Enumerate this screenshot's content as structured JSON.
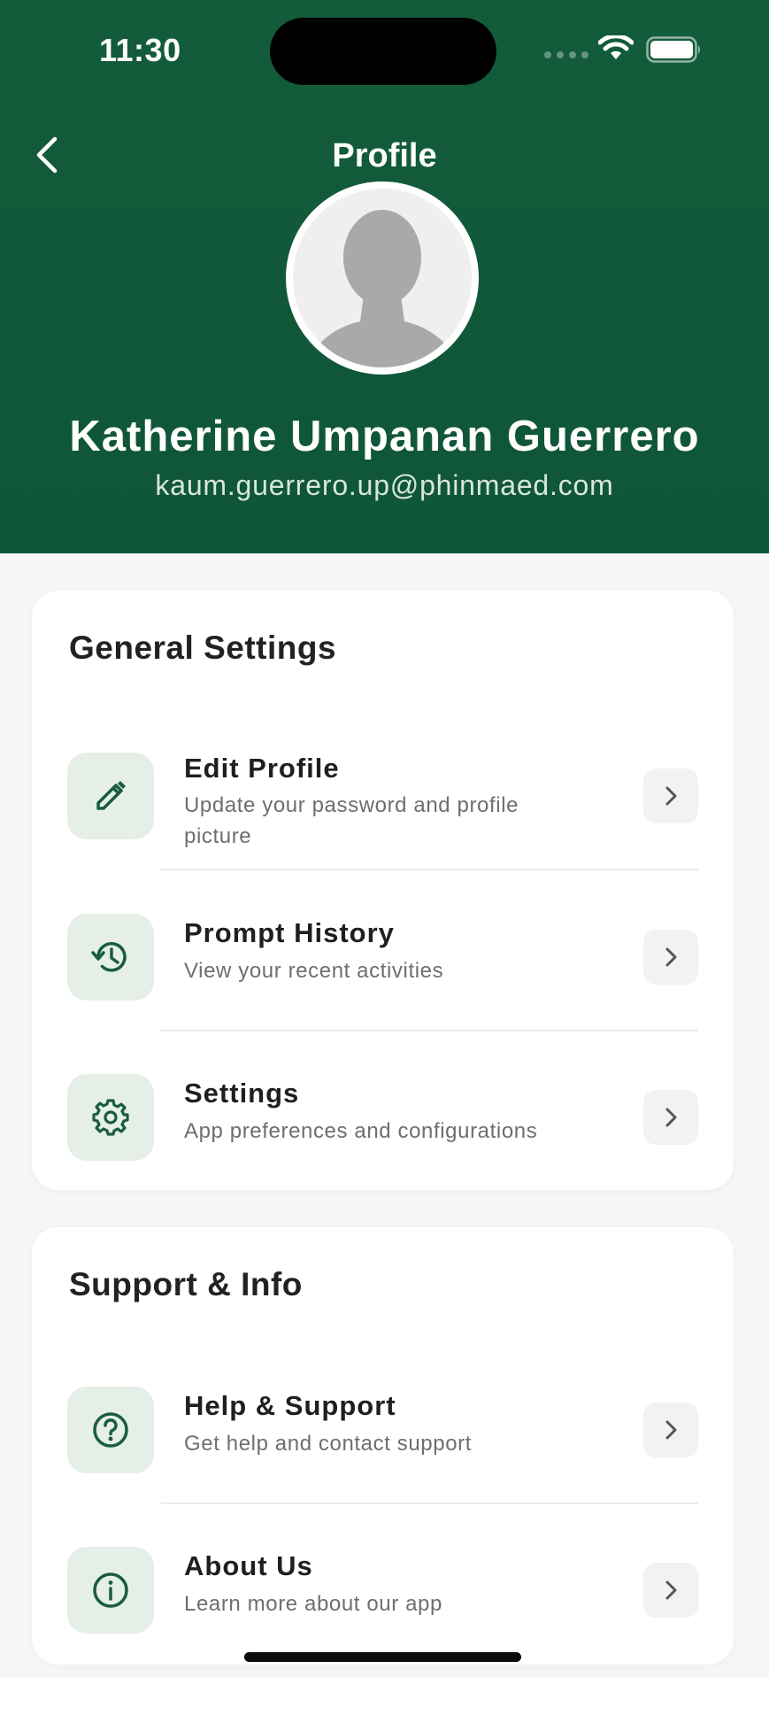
{
  "status_bar": {
    "time": "11:30"
  },
  "header": {
    "title": "Profile",
    "back_icon": "chevron-left-icon",
    "avatar_icon": "person-silhouette-icon",
    "user_name": "Katherine Umpanan Guerrero",
    "user_email": "kaum.guerrero.up@phinmaed.com"
  },
  "general_settings": {
    "title": "General Settings",
    "items": [
      {
        "title": "Edit Profile",
        "subtitle": "Update your password and profile picture",
        "icon": "pencil-icon"
      },
      {
        "title": "Prompt History",
        "subtitle": "View your recent activities",
        "icon": "history-icon"
      },
      {
        "title": "Settings",
        "subtitle": "App preferences and configurations",
        "icon": "gear-icon"
      }
    ]
  },
  "support_info": {
    "title": "Support & Info",
    "items": [
      {
        "title": "Help & Support",
        "subtitle": "Get help and contact support",
        "icon": "question-circle-icon"
      },
      {
        "title": "About Us",
        "subtitle": "Learn more about our app",
        "icon": "info-circle-icon"
      }
    ]
  },
  "colors": {
    "header_bg": "#125a3a",
    "accent": "#1a5c3f",
    "icon_bg": "#e5efe8",
    "page_bg": "#f6f6f6"
  }
}
